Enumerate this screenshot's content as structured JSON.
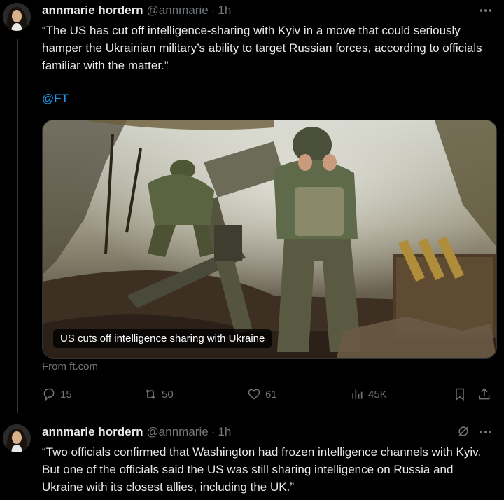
{
  "tweets": [
    {
      "author_name": "annmarie hordern",
      "handle": "@annmarie",
      "separator": "·",
      "time": "1h",
      "text": "“The US has cut off intelligence-sharing with Kyiv in a move that could seriously hamper the Ukrainian military’s ability to target Russian forces, according to officials familiar with the matter.”",
      "mention": "@FT",
      "card": {
        "caption": "US cuts off intelligence sharing with Ukraine",
        "source": "From ft.com"
      },
      "stats": {
        "replies": "15",
        "reposts": "50",
        "likes": "61",
        "views": "45K"
      }
    },
    {
      "author_name": "annmarie hordern",
      "handle": "@annmarie",
      "separator": "·",
      "time": "1h",
      "text": "“Two officials confirmed that Washington had frozen intelligence channels with Kyiv. But one of the officials said the US was still sharing intelligence on Russia and Ukraine with its closest allies, including the UK.”"
    }
  ],
  "icons": {
    "more": "more-horizontal-icon",
    "reply": "reply-icon",
    "repost": "repost-icon",
    "like": "heart-icon",
    "views": "views-chart-icon",
    "bookmark": "bookmark-icon",
    "share": "share-icon",
    "grok": "grok-icon"
  },
  "colors": {
    "background": "#000000",
    "text": "#e7e9ea",
    "secondary": "#71767b",
    "link": "#1d9bf0"
  }
}
